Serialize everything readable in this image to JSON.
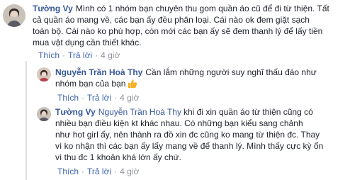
{
  "comments": [
    {
      "author": "Tường Vy",
      "lines": [
        "Mình có 1 nhóm bạn chuyên thu gom quần áo cũ để đi từ thiện. Tất",
        "cả quần áo mang về, các bạn ấy đều phân loại. Cái nào ok đem giặt sạch",
        "toàn bộ. Cái nào ko phù hợp, còn mới các bạn ấy sẽ đem thanh lý để lấy tiền",
        "mua vật dụng cần thiết khác."
      ],
      "actions": {
        "like": "Thích",
        "reply": "Trả lời",
        "time": "4 giờ"
      }
    },
    {
      "author": "Nguyễn Trần Hoà Thy",
      "lines": [
        "Cần lắm những người suy nghĩ thấu đáo như",
        "nhóm bạn của bạn"
      ],
      "emoji": "thumbs-up",
      "actions": {
        "like": "Thích",
        "reply": "Trả lời",
        "time": "4 giờ"
      }
    },
    {
      "author": "Tường Vy",
      "mention": "Nguyễn Trần Hoà Thy",
      "lines": [
        "khi đi xin quần áo từ thiện cũng có",
        "nhiều bạn điều kiện kt khác nhau. Có những bạn kiểu sang chảnh",
        "như hot girl ấy, nên thành ra đồ xin đc cũng ko mang từ thiện đc. Thay",
        "vì ko nhận thì các bạn ấy lấy mang về để thanh lý. Mình thấy cực kỳ ổn",
        "vì thu đc 1 khoản khá lớn ấy chứ."
      ],
      "actions": {
        "like": "Thích",
        "reply": "Trả lời",
        "time": "4 giờ"
      }
    }
  ],
  "colors": {
    "link": "#365899",
    "action": "#4267b2",
    "meta": "#90949c",
    "text": "#1d2129",
    "thread_bar": "#dddfe2"
  }
}
